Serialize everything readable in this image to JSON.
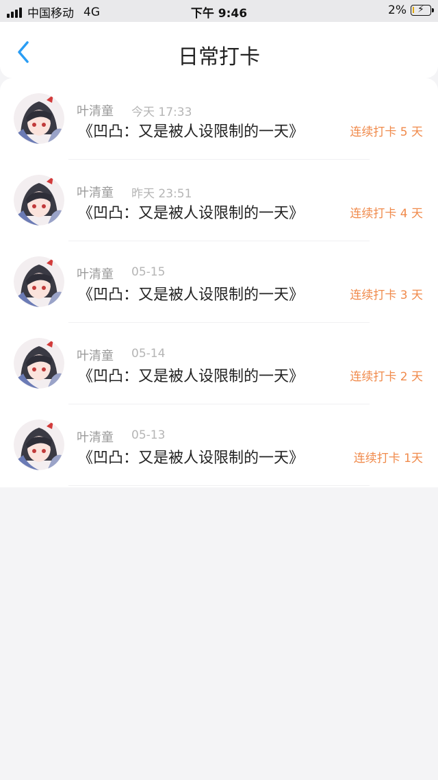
{
  "status_bar": {
    "carrier": "中国移动",
    "network": "4G",
    "time": "下午 9:46",
    "battery_percent": "2%"
  },
  "header": {
    "title": "日常打卡"
  },
  "entries": [
    {
      "user": "叶清童",
      "time": "今天 17:33",
      "book": "《凹凸：又是被人设限制的一天》",
      "streak": "连续打卡 5 天"
    },
    {
      "user": "叶清童",
      "time": "昨天 23:51",
      "book": "《凹凸：又是被人设限制的一天》",
      "streak": "连续打卡 4 天"
    },
    {
      "user": "叶清童",
      "time": "05-15",
      "book": "《凹凸：又是被人设限制的一天》",
      "streak": "连续打卡 3 天"
    },
    {
      "user": "叶清童",
      "time": "05-14",
      "book": "《凹凸：又是被人设限制的一天》",
      "streak": "连续打卡 2 天"
    },
    {
      "user": "叶清童",
      "time": "05-13",
      "book": "《凹凸：又是被人设限制的一天》",
      "streak": "连续打卡 1天"
    }
  ],
  "colors": {
    "accent": "#f08a4b",
    "back_icon": "#2a9df4"
  }
}
